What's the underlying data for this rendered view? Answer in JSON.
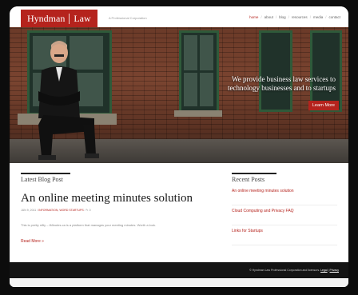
{
  "header": {
    "logo_left": "Hyndman",
    "logo_right": "Law",
    "tagline": "A Professional Corporation",
    "nav": [
      {
        "label": "home",
        "active": true
      },
      {
        "label": "about",
        "active": false
      },
      {
        "label": "blog",
        "active": false
      },
      {
        "label": "resources",
        "active": false
      },
      {
        "label": "media",
        "active": false
      },
      {
        "label": "contact",
        "active": false
      }
    ]
  },
  "hero": {
    "headline_line1": "We provide business law services to",
    "headline_line2": "technology businesses and to startups",
    "cta_label": "Learn More"
  },
  "latest": {
    "section_title": "Latest Blog Post",
    "post_title": "An online meeting minutes solution",
    "date": "JUN 9, 2011",
    "categories": "INFORMATION, WORD STARTUPS",
    "comments": "0",
    "excerpt": "This is pretty nifty – iMinutes.ca is a platform that manages your meeting minutes. Worth a look.",
    "read_more": "Read More »"
  },
  "recent": {
    "section_title": "Recent Posts",
    "items": [
      "An online meeting minutes solution",
      "Cloud Computing and Privacy FAQ",
      "Links for Startups"
    ]
  },
  "footer": {
    "copyright": "© Hyndman Law Professional Corporation and licensors.",
    "legal": "Legal",
    "privacy": "Privacy"
  },
  "colors": {
    "brand_red": "#b5231d",
    "footer_bg": "#141414"
  }
}
